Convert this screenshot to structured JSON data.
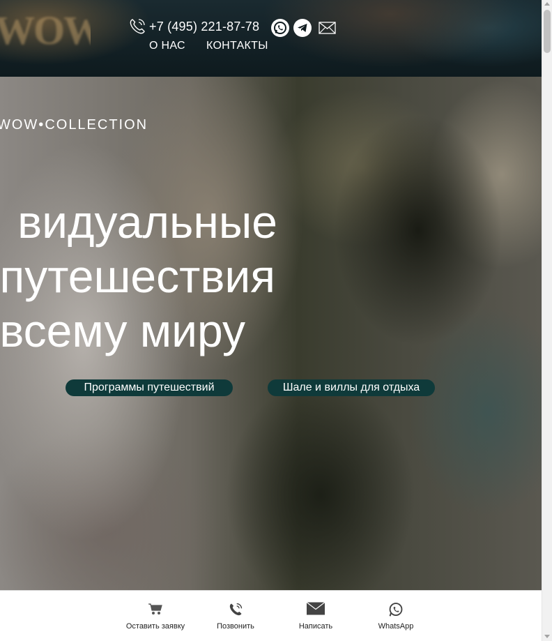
{
  "header": {
    "logo_text": "WOW",
    "phone": "+7 (495) 221-87-78",
    "nav": {
      "about": "О НАС",
      "contacts": "КОНТАКТЫ"
    },
    "icons": [
      "phone-icon",
      "whatsapp-icon",
      "telegram-icon",
      "mail-icon"
    ]
  },
  "hero": {
    "brand": "WOW•COLLECTION",
    "headline": [
      "видуальные",
      "путешествия",
      "всему миру"
    ],
    "buttons": {
      "programs": "Программы путешествий",
      "chalets": "Шале и виллы для отдыха"
    }
  },
  "bottom_bar": {
    "order": "Оставить заявку",
    "call": "Позвонить",
    "write": "Написать",
    "whatsapp": "WhatsApp"
  },
  "colors": {
    "button_bg": "#0f3a3a",
    "bottom_bar_bg": "#ffffff",
    "text_light": "#ffffff"
  }
}
